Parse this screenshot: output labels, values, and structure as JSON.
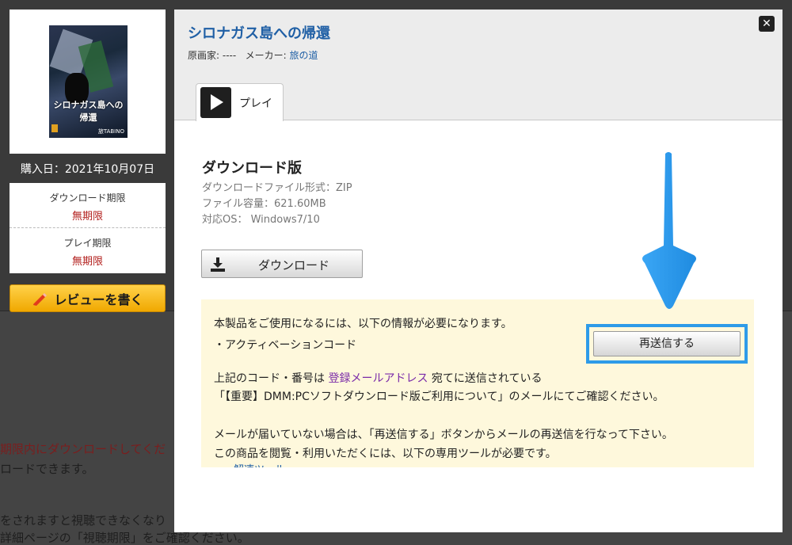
{
  "background": {
    "line1": "期限内にダウンロードしてくだ",
    "line2": "ロードできます。",
    "line3": "をされますと視聴できなくなり",
    "line4": "詳細ページの「視聴期限」をご確認ください。"
  },
  "sidebar": {
    "cover_title": "シロナガス島への帰還",
    "cover_logo": "旅TABINO",
    "purchase_date": "購入日：2021年10月07日",
    "download_limit_label": "ダウンロード期限",
    "download_limit_value": "無期限",
    "play_limit_label": "プレイ期限",
    "play_limit_value": "無期限",
    "review_button": "レビューを書く"
  },
  "modal": {
    "title": "シロナガス島への帰還",
    "illustrator_label": "原画家: ----",
    "maker_label": "メーカー:",
    "maker_value": "旅の道",
    "close_symbol": "✕",
    "tab_play": "プレイ",
    "section_title": "ダウンロード版",
    "file_format": "ダウンロードファイル形式：ZIP",
    "file_size": "ファイル容量：621.60MB",
    "os": "対応OS： Windows7/10",
    "download_button": "ダウンロード",
    "notice": {
      "line1": "本製品をご使用になるには、以下の情報が必要になります。",
      "line2": "・アクティベーションコード",
      "line3_pre": "上記のコード・番号は",
      "line3_link": "登録メールアドレス",
      "line3_post": "宛てに送信されている",
      "line4": "「【重要】DMM:PCソフトダウンロード版ご利用について」のメールにてご確認ください。",
      "line5": "メールが届いていない場合は、「再送信する」ボタンからメールの再送信を行なって下さい。",
      "line6": "この商品を閲覧・利用いただくには、以下の専用ツールが必要です。",
      "line7_cut": "・解凍ツール"
    },
    "resend_button": "再送信する"
  },
  "colors": {
    "title_blue": "#1f5fa5",
    "limit_red": "#b3201e",
    "highlight_blue": "#2e9be8",
    "notice_bg": "#fef8dc"
  }
}
